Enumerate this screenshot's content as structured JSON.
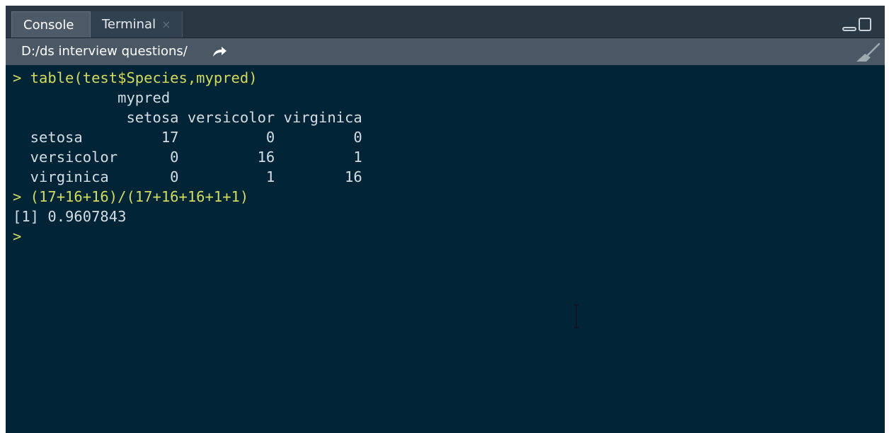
{
  "tabs": [
    {
      "label": "Console",
      "active": true
    },
    {
      "label": "Terminal",
      "close_icon": "×",
      "active": false
    }
  ],
  "path": {
    "text": "D:/ds interview questions/",
    "icon": "share-arrow-icon"
  },
  "window_controls": {
    "minimize_icon": "minimize-icon",
    "maximize_icon": "maximize-icon"
  },
  "clear_console_icon": "broom-icon",
  "console": {
    "lines": [
      {
        "type": "command",
        "text": "> table(test$Species,mypred)"
      },
      {
        "type": "output",
        "text": "            mypred"
      },
      {
        "type": "output",
        "text": "             setosa versicolor virginica"
      },
      {
        "type": "output",
        "text": "  setosa         17          0         0"
      },
      {
        "type": "output",
        "text": "  versicolor      0         16         1"
      },
      {
        "type": "output",
        "text": "  virginica       0          1        16"
      },
      {
        "type": "command",
        "text": "> (17+16+16)/(17+16+16+1+1)"
      },
      {
        "type": "output",
        "text": "[1] 0.9607843"
      },
      {
        "type": "command",
        "text": ">"
      }
    ]
  },
  "colors": {
    "background": "#012537",
    "command_text": "#d3db58",
    "output_text": "#d4dde3",
    "tabbar": "#2a3844",
    "pathbar": "#4a5865"
  }
}
